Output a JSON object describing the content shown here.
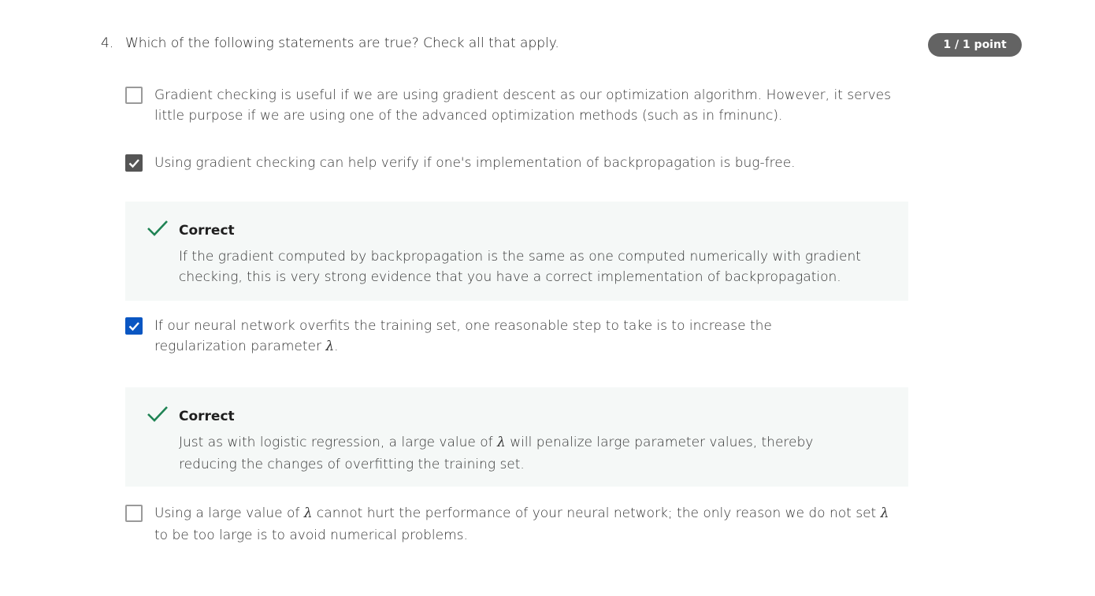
{
  "question": {
    "number": "4.",
    "prompt": "Which of the following statements are true? Check all that apply.",
    "score": "1 / 1 point"
  },
  "options": [
    {
      "checked": false,
      "text": "Gradient checking is useful if we are using gradient descent as our optimization algorithm.  However, it serves little purpose if we are using one of the advanced optimization methods (such as in fminunc)."
    },
    {
      "checked": true,
      "text": "Using gradient checking can help verify if one's implementation of backpropagation is bug-free.",
      "feedback": {
        "title": "Correct",
        "text": "If the gradient computed by backpropagation is the same as one computed numerically with gradient checking, this is very strong evidence that you have a correct implementation of backpropagation."
      }
    },
    {
      "checked": true,
      "text_before": "If our neural network overfits the training set, one reasonable step to take is to increase the regularization parameter ",
      "lambda": "λ",
      "text_after": ".",
      "feedback": {
        "title": "Correct",
        "text_before": "Just as with logistic regression, a large value of ",
        "lambda": "λ",
        "text_after": " will penalize large parameter values, thereby reducing the changes of overfitting the training set."
      }
    },
    {
      "checked": false,
      "text_part1": "Using a large value of ",
      "lambda1": "λ",
      "text_part2": " cannot hurt the performance of your neural network; the only reason we do not set ",
      "lambda2": "λ",
      "text_part3": " to be too large is to avoid numerical problems."
    }
  ],
  "colors": {
    "badge_bg": "#636363",
    "checkbox_checked_gray": "#555555",
    "checkbox_checked_blue": "#0a56c2",
    "feedback_bg": "#f5f8f7",
    "correct_green": "#1f8354"
  },
  "icons": {
    "checkbox_check": "check-icon",
    "correct": "correct-check-icon"
  }
}
